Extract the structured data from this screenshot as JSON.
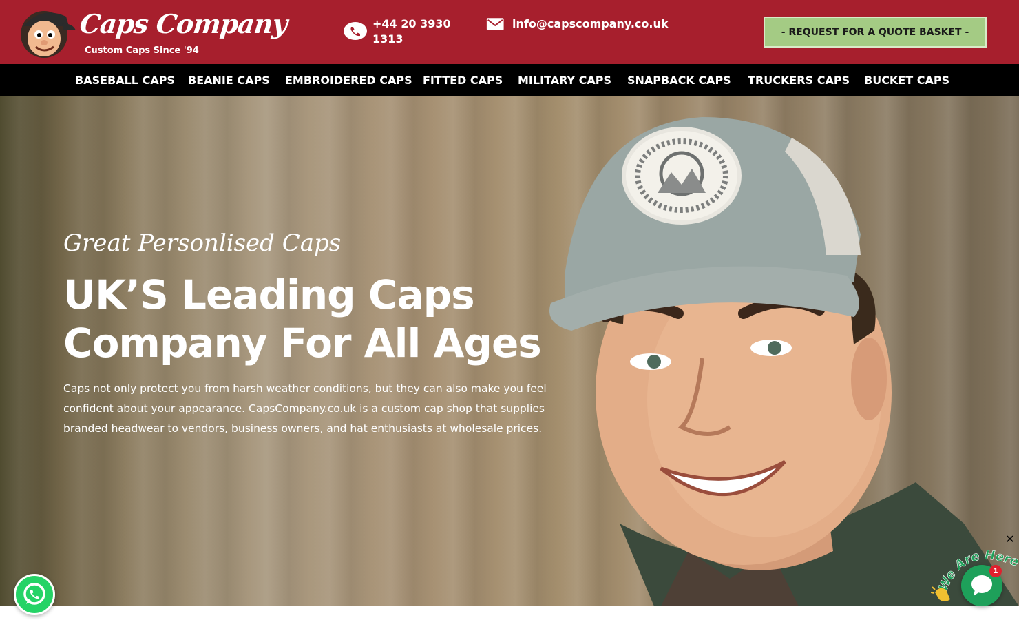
{
  "brand": {
    "name": "Caps Company",
    "tagline": "Custom Caps Since '94",
    "colors": {
      "header_red": "#a71f2d",
      "nav_black": "#000000",
      "quote_green": "#a4cb84"
    }
  },
  "header": {
    "phone": {
      "icon": "phone-icon",
      "number": "+44 20 3930\n1313"
    },
    "email": {
      "icon": "envelope-icon",
      "address": "info@capscompany.co.uk"
    },
    "quote_button": "- REQUEST FOR A QUOTE BASKET -"
  },
  "nav": {
    "items": [
      {
        "label": "BASEBALL CAPS"
      },
      {
        "label": "BEANIE CAPS"
      },
      {
        "label": "EMBROIDERED CAPS"
      },
      {
        "label": "FITTED CAPS"
      },
      {
        "label": "MILITARY CAPS"
      },
      {
        "label": "SNAPBACK CAPS"
      },
      {
        "label": "TRUCKERS CAPS"
      },
      {
        "label": "BUCKET CAPS"
      }
    ]
  },
  "hero": {
    "kicker": "Great Personlised Caps",
    "headline": "UK’S Leading Caps Company For All Ages",
    "intro": "Caps not only protect you from harsh weather conditions, but they can also make you feel confident about your appearance. CapsCompany.co.uk is a custom cap shop that supplies branded headwear to vendors, business owners, and hat enthusiasts at wholesale prices."
  },
  "widgets": {
    "whatsapp": {
      "icon": "whatsapp-icon"
    },
    "chat": {
      "banner_text": "We Are Here!",
      "badge_count": "1",
      "close_icon": "close-icon",
      "wave_icon": "waving-hand-icon"
    }
  }
}
